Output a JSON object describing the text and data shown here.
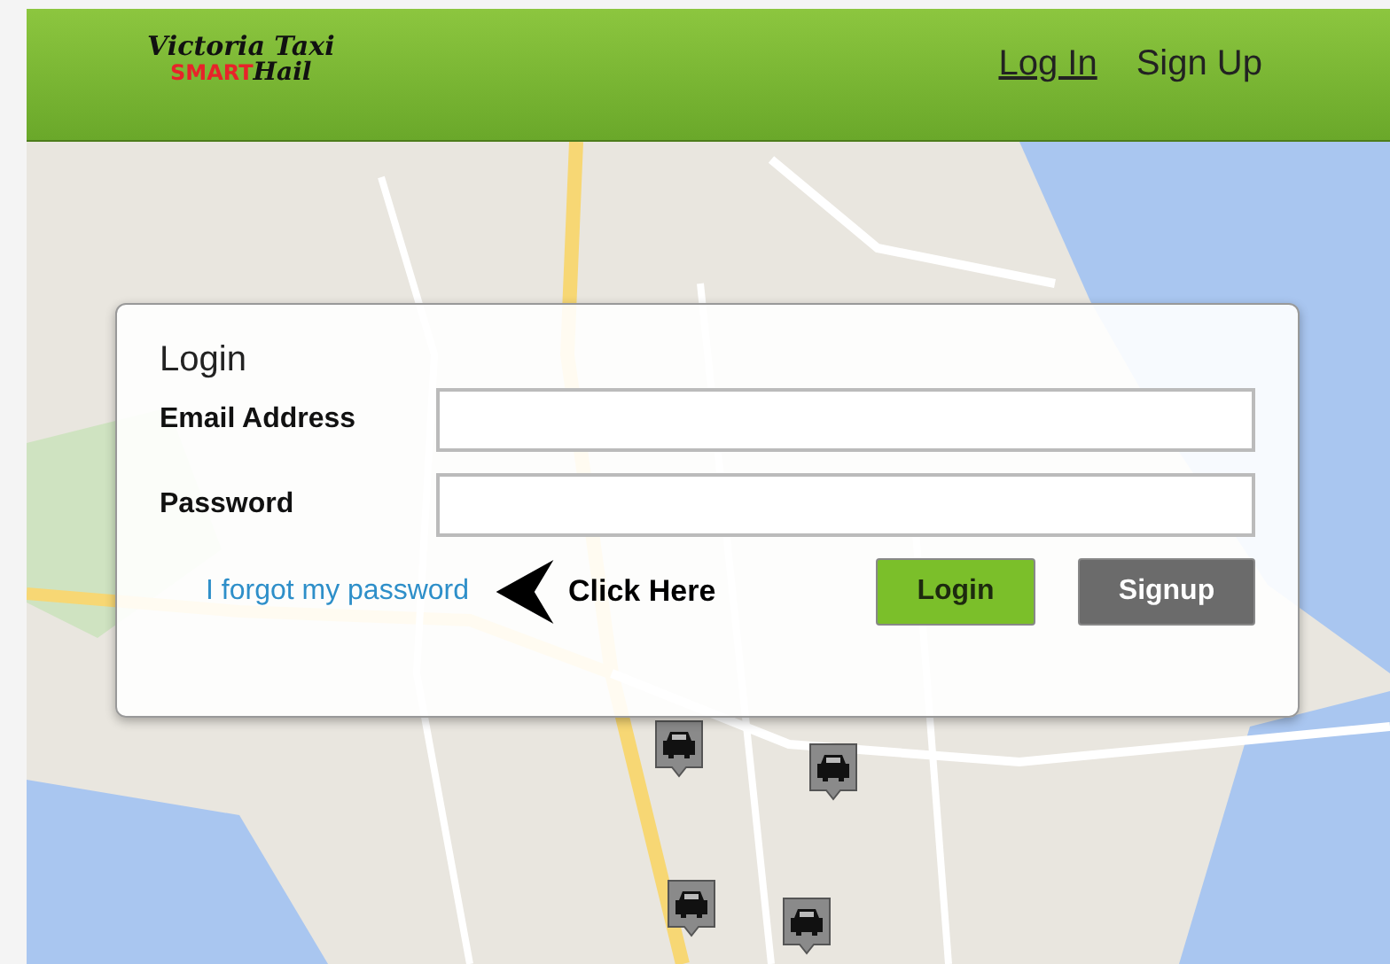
{
  "header": {
    "logo": {
      "line_1": "Victoria Taxi",
      "line_2_red": "SMART",
      "line_2": "Hail"
    },
    "nav": [
      {
        "label": "Log In",
        "selected": true
      },
      {
        "label": "Sign Up",
        "selected": false
      }
    ]
  },
  "login": {
    "title": "Login",
    "fields": [
      {
        "label": "Email Address"
      },
      {
        "label": "Password"
      }
    ],
    "forgot_link": "I forgot my password",
    "annotation": "Click Here",
    "buttons": [
      {
        "label": "Login",
        "kind": "primary"
      },
      {
        "label": "Signup",
        "kind": "secondary"
      }
    ]
  }
}
